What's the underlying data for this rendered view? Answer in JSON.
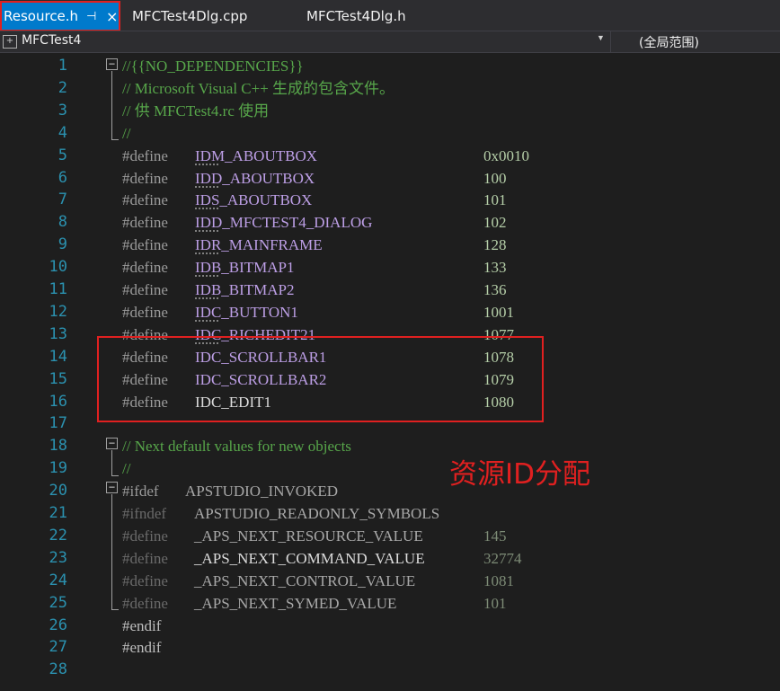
{
  "tabs": [
    {
      "label": "Resource.h",
      "active": true,
      "pin": "⊣",
      "close": "×"
    },
    {
      "label": "MFCTest4Dlg.cpp",
      "active": false
    },
    {
      "label": "MFCTest4Dlg.h",
      "active": false
    }
  ],
  "navbar": {
    "project_icon": "+",
    "project": "MFCTest4",
    "scope": "(全局范围)"
  },
  "annotation": "资源ID分配",
  "colors": {
    "accent": "#007acc",
    "highlight_red": "#e02020",
    "line_number": "#2b91af",
    "comment": "#57a64a",
    "macro": "#bd9fe6",
    "number": "#b5cea8"
  },
  "code": {
    "lines": [
      {
        "n": "1",
        "text": "//{{NO_DEPENDENCIES}}",
        "kind": "comment"
      },
      {
        "n": "2",
        "text": "// Microsoft Visual C++ 生成的包含文件。",
        "kind": "comment"
      },
      {
        "n": "3",
        "text": "// 供 MFCTest4.rc 使用",
        "kind": "comment"
      },
      {
        "n": "4",
        "text": "//",
        "kind": "comment"
      },
      {
        "n": "5",
        "kw": "#define",
        "name": "IDM_ABOUTBOX",
        "value": "0x0010",
        "kind": "define"
      },
      {
        "n": "6",
        "kw": "#define",
        "name": "IDD_ABOUTBOX",
        "value": "100",
        "kind": "define"
      },
      {
        "n": "7",
        "kw": "#define",
        "name": "IDS_ABOUTBOX",
        "value": "101",
        "kind": "define"
      },
      {
        "n": "8",
        "kw": "#define",
        "name": "IDD_MFCTEST4_DIALOG",
        "value": "102",
        "kind": "define"
      },
      {
        "n": "9",
        "kw": "#define",
        "name": "IDR_MAINFRAME",
        "value": "128",
        "kind": "define"
      },
      {
        "n": "10",
        "kw": "#define",
        "name": "IDB_BITMAP1",
        "value": "133",
        "kind": "define"
      },
      {
        "n": "11",
        "kw": "#define",
        "name": "IDB_BITMAP2",
        "value": "136",
        "kind": "define"
      },
      {
        "n": "12",
        "kw": "#define",
        "name": "IDC_BUTTON1",
        "value": "1001",
        "kind": "define"
      },
      {
        "n": "13",
        "kw": "#define",
        "name": "IDC_RICHEDIT21",
        "value": "1077",
        "kind": "define"
      },
      {
        "n": "14",
        "kw": "#define",
        "name": "IDC_SCROLLBAR1",
        "value": "1078",
        "kind": "define"
      },
      {
        "n": "15",
        "kw": "#define",
        "name": "IDC_SCROLLBAR2",
        "value": "1079",
        "kind": "define"
      },
      {
        "n": "16",
        "kw": "#define",
        "name": "IDC_EDIT1",
        "value": "1080",
        "kind": "define-plain"
      },
      {
        "n": "17",
        "text": "",
        "kind": "blank"
      },
      {
        "n": "18",
        "text": "// Next default values for new objects",
        "kind": "comment"
      },
      {
        "n": "19",
        "text": "//",
        "kind": "comment"
      },
      {
        "n": "20",
        "kw": "#ifdef",
        "name": "APSTUDIO_INVOKED",
        "kind": "ifdef"
      },
      {
        "n": "21",
        "kw": "#ifndef",
        "name": "APSTUDIO_READONLY_SYMBOLS",
        "kind": "ifdef-dim"
      },
      {
        "n": "22",
        "kw": "#define",
        "name": "_APS_NEXT_RESOURCE_VALUE",
        "value": "145",
        "kind": "define-dim"
      },
      {
        "n": "23",
        "kw": "#define",
        "name": "_APS_NEXT_COMMAND_VALUE",
        "value": "32774",
        "kind": "define-dim"
      },
      {
        "n": "24",
        "kw": "#define",
        "name": "_APS_NEXT_CONTROL_VALUE",
        "value": "1081",
        "kind": "define-dim"
      },
      {
        "n": "25",
        "kw": "#define",
        "name": "_APS_NEXT_SYMED_VALUE",
        "value": "101",
        "kind": "define-dim"
      },
      {
        "n": "26",
        "text": "#endif",
        "kind": "directive-dim"
      },
      {
        "n": "27",
        "text": "#endif",
        "kind": "directive"
      },
      {
        "n": "28",
        "text": "",
        "kind": "blank"
      }
    ]
  }
}
